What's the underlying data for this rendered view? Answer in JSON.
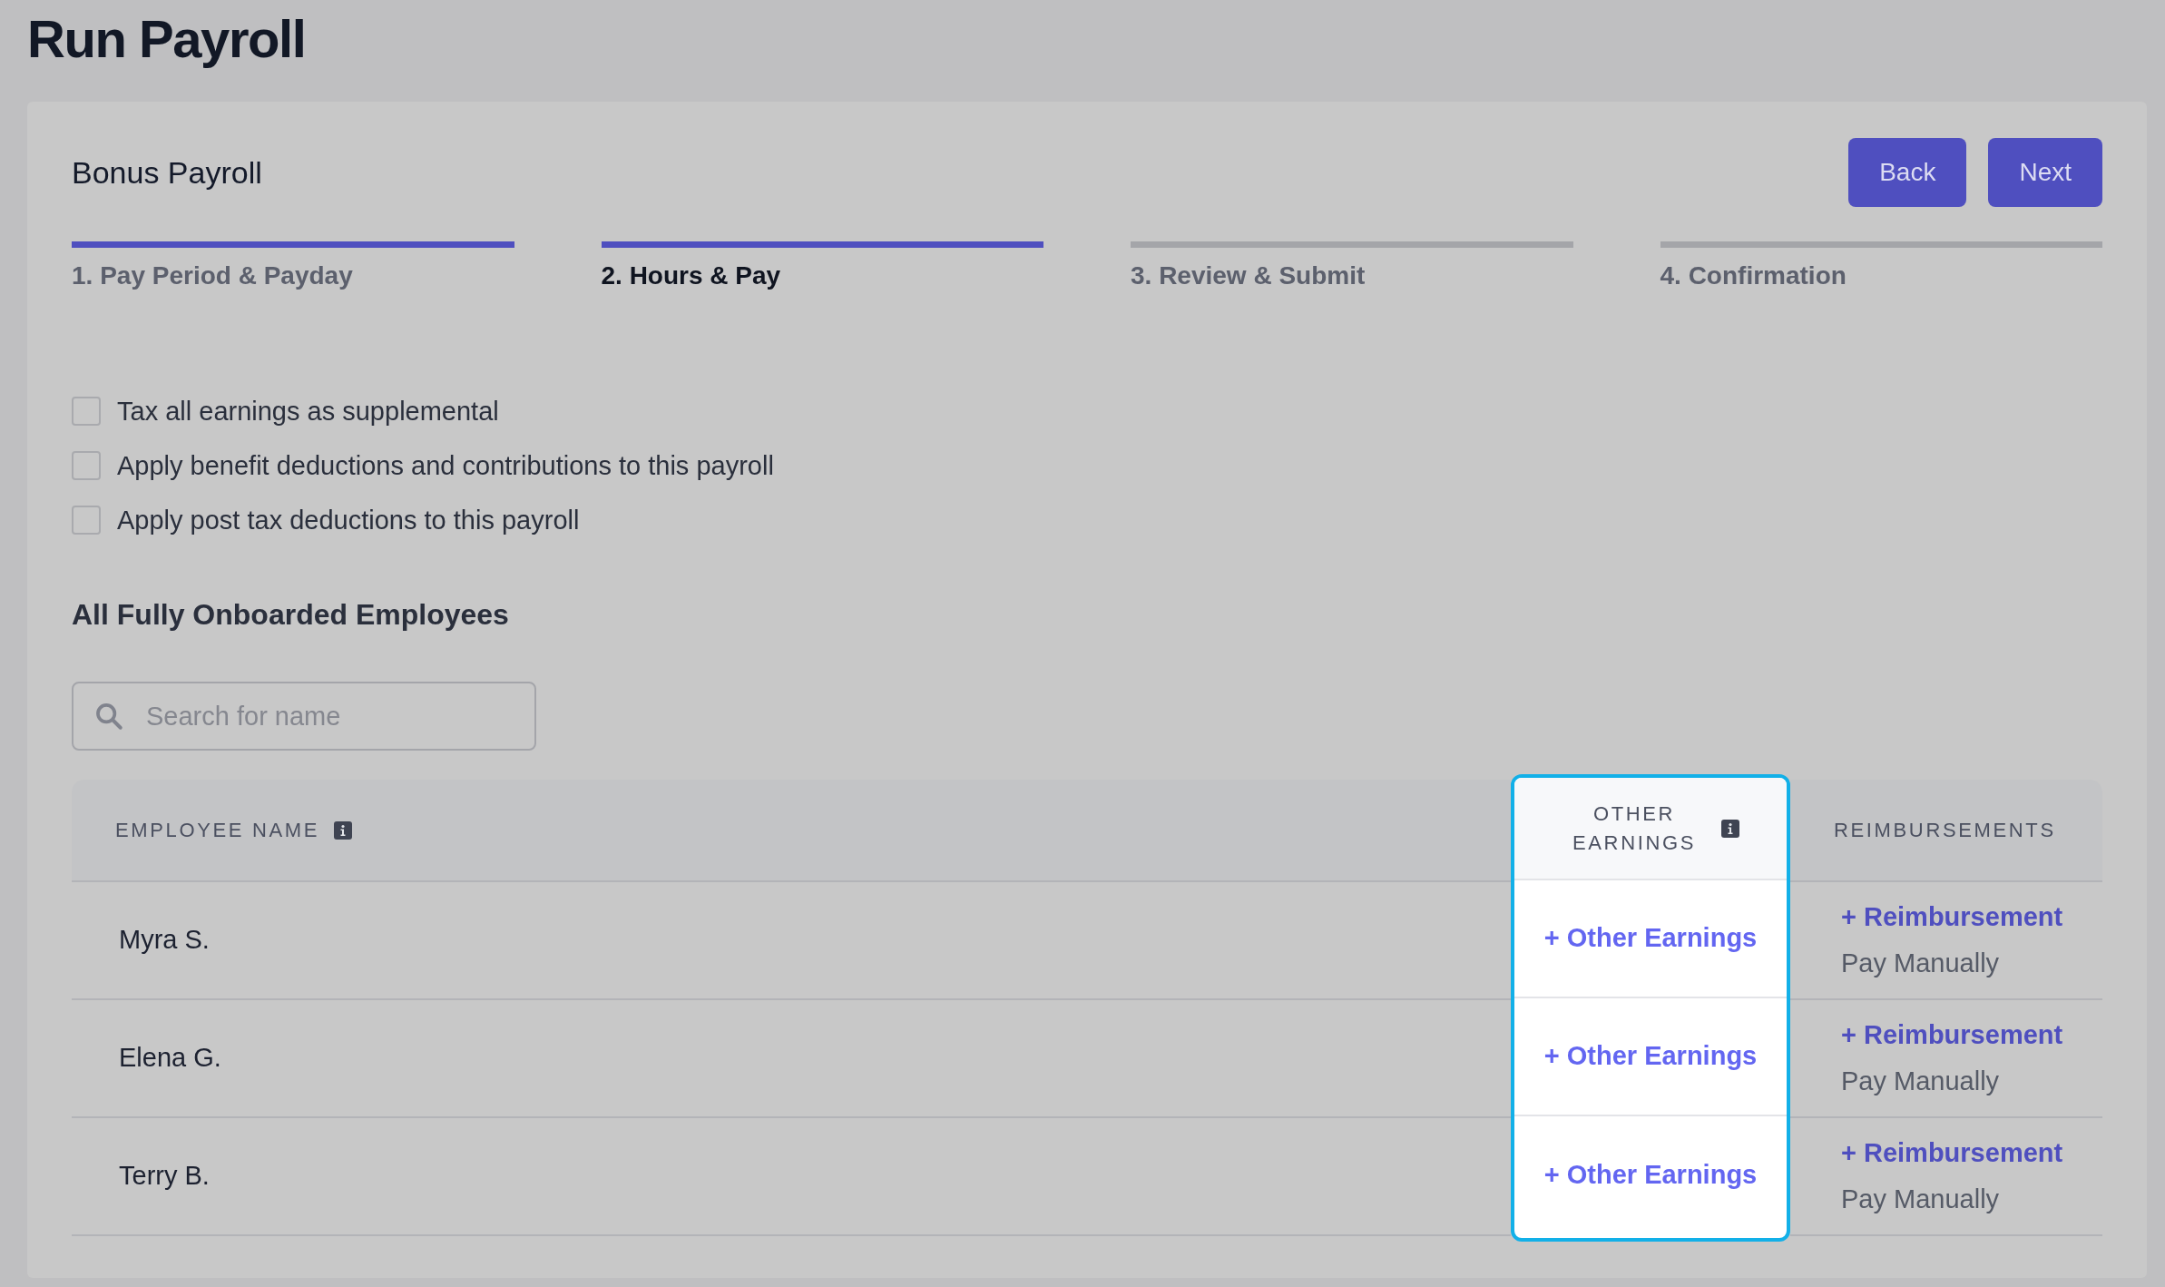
{
  "page": {
    "title": "Run Payroll"
  },
  "card": {
    "title": "Bonus Payroll",
    "buttons": [
      "Back",
      "Next"
    ]
  },
  "steps": [
    {
      "label": "1. Pay Period & Payday",
      "done": true,
      "selected": false
    },
    {
      "label": "2. Hours & Pay",
      "done": true,
      "selected": true
    },
    {
      "label": "3. Review & Submit",
      "done": false,
      "selected": false
    },
    {
      "label": "4. Confirmation",
      "done": false,
      "selected": false
    }
  ],
  "options": [
    {
      "label": "Tax all earnings as supplemental",
      "checked": false
    },
    {
      "label": "Apply benefit deductions and contributions to this payroll",
      "checked": false
    },
    {
      "label": "Apply post tax deductions to this payroll",
      "checked": false
    }
  ],
  "section": {
    "title": "All Fully Onboarded Employees"
  },
  "search": {
    "placeholder": "Search for name"
  },
  "table": {
    "columns": [
      {
        "label": "EMPLOYEE NAME",
        "info": true,
        "highlighted": false
      },
      {
        "label": "OTHER EARNINGS",
        "info": true,
        "highlighted": true
      },
      {
        "label": "REIMBURSEMENTS",
        "info": false,
        "highlighted": false
      }
    ],
    "rows": [
      {
        "name": "Myra S.",
        "other_earnings": "+ Other Earnings",
        "reimbursement": "+ Reimbursement",
        "pay_manually": "Pay Manually"
      },
      {
        "name": "Elena G.",
        "other_earnings": "+ Other Earnings",
        "reimbursement": "+ Reimbursement",
        "pay_manually": "Pay Manually"
      },
      {
        "name": "Terry B.",
        "other_earnings": "+ Other Earnings",
        "reimbursement": "+ Reimbursement",
        "pay_manually": "Pay Manually"
      }
    ]
  }
}
